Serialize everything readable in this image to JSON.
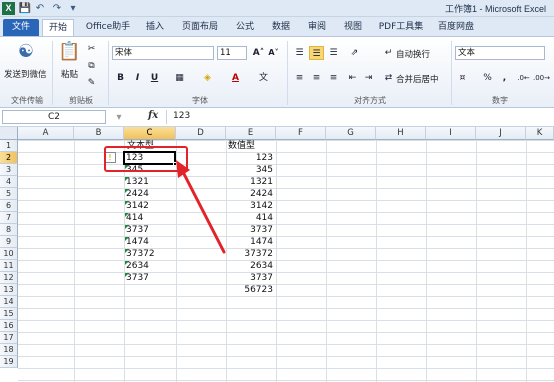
{
  "window": {
    "app_icon_label": "X",
    "quick_access": [
      "✓",
      "↶",
      "↷",
      "▾"
    ],
    "title": "工作簿1 - Microsoft Excel"
  },
  "tabs": [
    {
      "label": "文件"
    },
    {
      "label": "开始"
    },
    {
      "label": "Office助手"
    },
    {
      "label": "插入"
    },
    {
      "label": "页面布局"
    },
    {
      "label": "公式"
    },
    {
      "label": "数据"
    },
    {
      "label": "审阅"
    },
    {
      "label": "视图"
    },
    {
      "label": "PDF工具集"
    },
    {
      "label": "百度网盘"
    }
  ],
  "ribbon": {
    "send_wechat": "发送到微信",
    "group_file_transfer": "文件传输",
    "paste": "粘贴",
    "group_clipboard": "剪贴板",
    "font_name": "宋体",
    "font_size": "11",
    "grow_font": "A˄",
    "shrink_font": "A˅",
    "bold": "B",
    "italic": "I",
    "underline": "U",
    "phonetic": "文",
    "group_font": "字体",
    "wrap_text": "自动换行",
    "merge_center": "合并后居中",
    "group_alignment": "对齐方式",
    "number_format": "文本",
    "percent": "%",
    "comma": ",",
    "group_number": "数字"
  },
  "formula_bar": {
    "name_box": "C2",
    "fx": "fx",
    "content": "123"
  },
  "columns": [
    "A",
    "B",
    "C",
    "D",
    "E",
    "F",
    "G",
    "H",
    "I",
    "J",
    "K"
  ],
  "rows": [
    "1",
    "2",
    "3",
    "4",
    "5",
    "6",
    "7",
    "8",
    "9",
    "10",
    "11",
    "12",
    "13",
    "14",
    "15",
    "16",
    "17",
    "18",
    "19"
  ],
  "sheet": {
    "c1": "文本型",
    "e1": "数值型",
    "text_values": [
      "123",
      "345",
      "1321",
      "2424",
      "3142",
      "414",
      "3737",
      "1474",
      "37372",
      "2634",
      "3737"
    ],
    "number_values": [
      "123",
      "345",
      "1321",
      "2424",
      "3142",
      "414",
      "3737",
      "1474",
      "37372",
      "2634",
      "3737",
      "56723"
    ]
  },
  "error_indicator_icon": "!",
  "colors": {
    "file_tab": "#2a66b8",
    "selection_header": "#f1c15c",
    "annotation_red": "#e2232a",
    "text_number_marker": "#1e8a3c"
  }
}
